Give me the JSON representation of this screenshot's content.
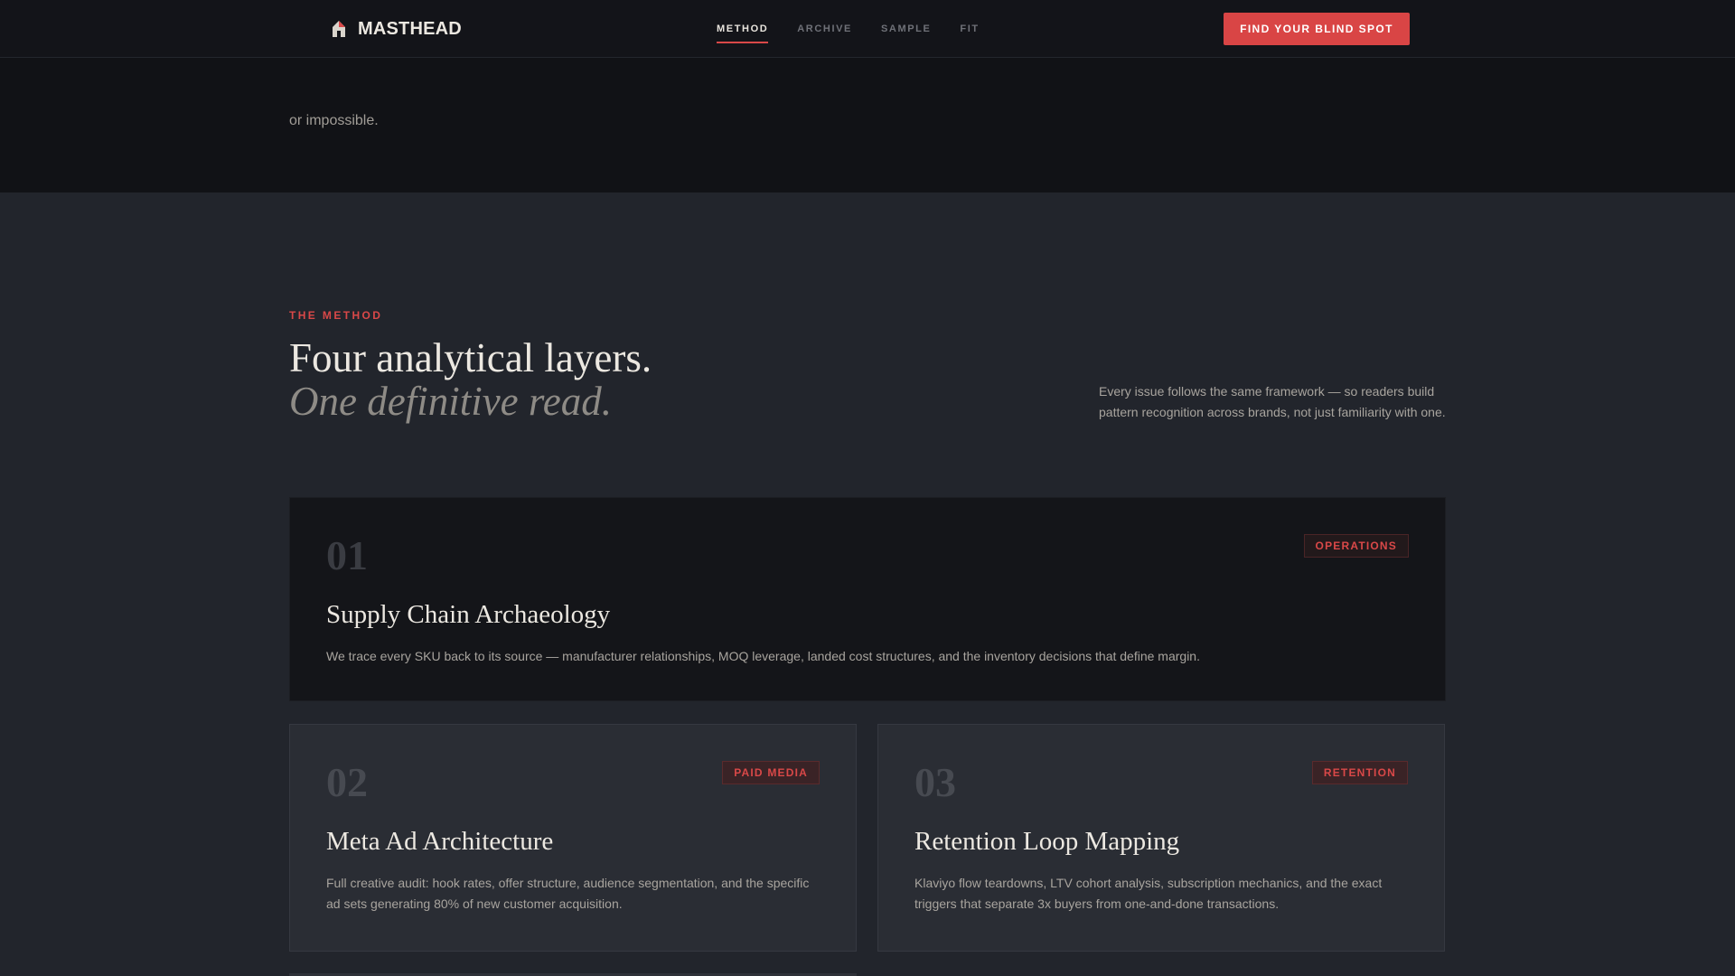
{
  "header": {
    "logo_text": "MASTHEAD",
    "nav": [
      {
        "label": "METHOD",
        "active": true
      },
      {
        "label": "ARCHIVE",
        "active": false
      },
      {
        "label": "SAMPLE",
        "active": false
      },
      {
        "label": "FIT",
        "active": false
      }
    ],
    "cta_label": "FIND YOUR BLIND SPOT"
  },
  "top": {
    "text": "or impossible."
  },
  "method": {
    "eyebrow": "THE METHOD",
    "headline": "Four analytical layers.",
    "headline_italic": "One definitive read.",
    "intro": "Every issue follows the same framework — so readers build pattern recognition across brands, not just familiarity with one.",
    "cards": [
      {
        "number": "01",
        "tag": "OPERATIONS",
        "title": "Supply Chain Archaeology",
        "desc": "We trace every SKU back to its source — manufacturer relationships, MOQ leverage, landed cost structures, and the inventory decisions that define margin."
      },
      {
        "number": "02",
        "tag": "PAID MEDIA",
        "title": "Meta Ad Architecture",
        "desc": "Full creative audit: hook rates, offer structure, audience segmentation, and the specific ad sets generating 80% of new customer acquisition."
      },
      {
        "number": "03",
        "tag": "RETENTION",
        "title": "Retention Loop Mapping",
        "desc": "Klaviyo flow teardowns, LTV cohort analysis, subscription mechanics, and the exact triggers that separate 3x buyers from one-and-done transactions."
      }
    ]
  },
  "colors": {
    "accent": "#d94848",
    "header_bg": "#131419",
    "section_bg": "#22252c",
    "card_bg": "#2a2d34",
    "featured_bg": "#141519"
  },
  "icons": {
    "logo": "masthead-house-icon"
  }
}
